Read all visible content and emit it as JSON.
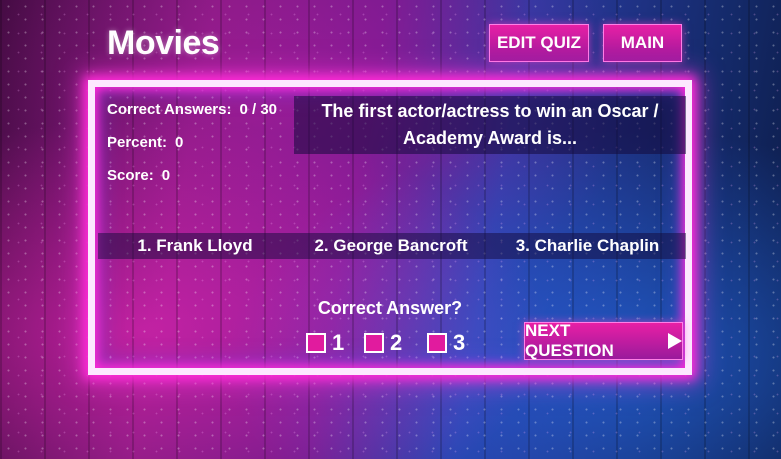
{
  "quiz": {
    "title": "Movies"
  },
  "header": {
    "edit_quiz_label": "EDIT QUIZ",
    "main_label": "MAIN"
  },
  "stats": {
    "correct_label": "Correct Answers:",
    "correct_value": "0 / 30",
    "percent_label": "Percent:",
    "percent_value": "0",
    "score_label": "Score:",
    "score_value": "0"
  },
  "question": {
    "text": "The first actor/actress to win an Oscar / Academy Award is..."
  },
  "answers": [
    {
      "label": "1. Frank Lloyd"
    },
    {
      "label": "2. George Bancroft"
    },
    {
      "label": "3. Charlie Chaplin"
    }
  ],
  "response": {
    "prompt": "Correct Answer?",
    "options": [
      "1",
      "2",
      "3"
    ]
  },
  "next_label": "NEXT QUESTION",
  "colors": {
    "button_pink": "#e81fa5",
    "frame_glow": "#ff2ad8",
    "checkbox_fill": "#e11b9e"
  }
}
